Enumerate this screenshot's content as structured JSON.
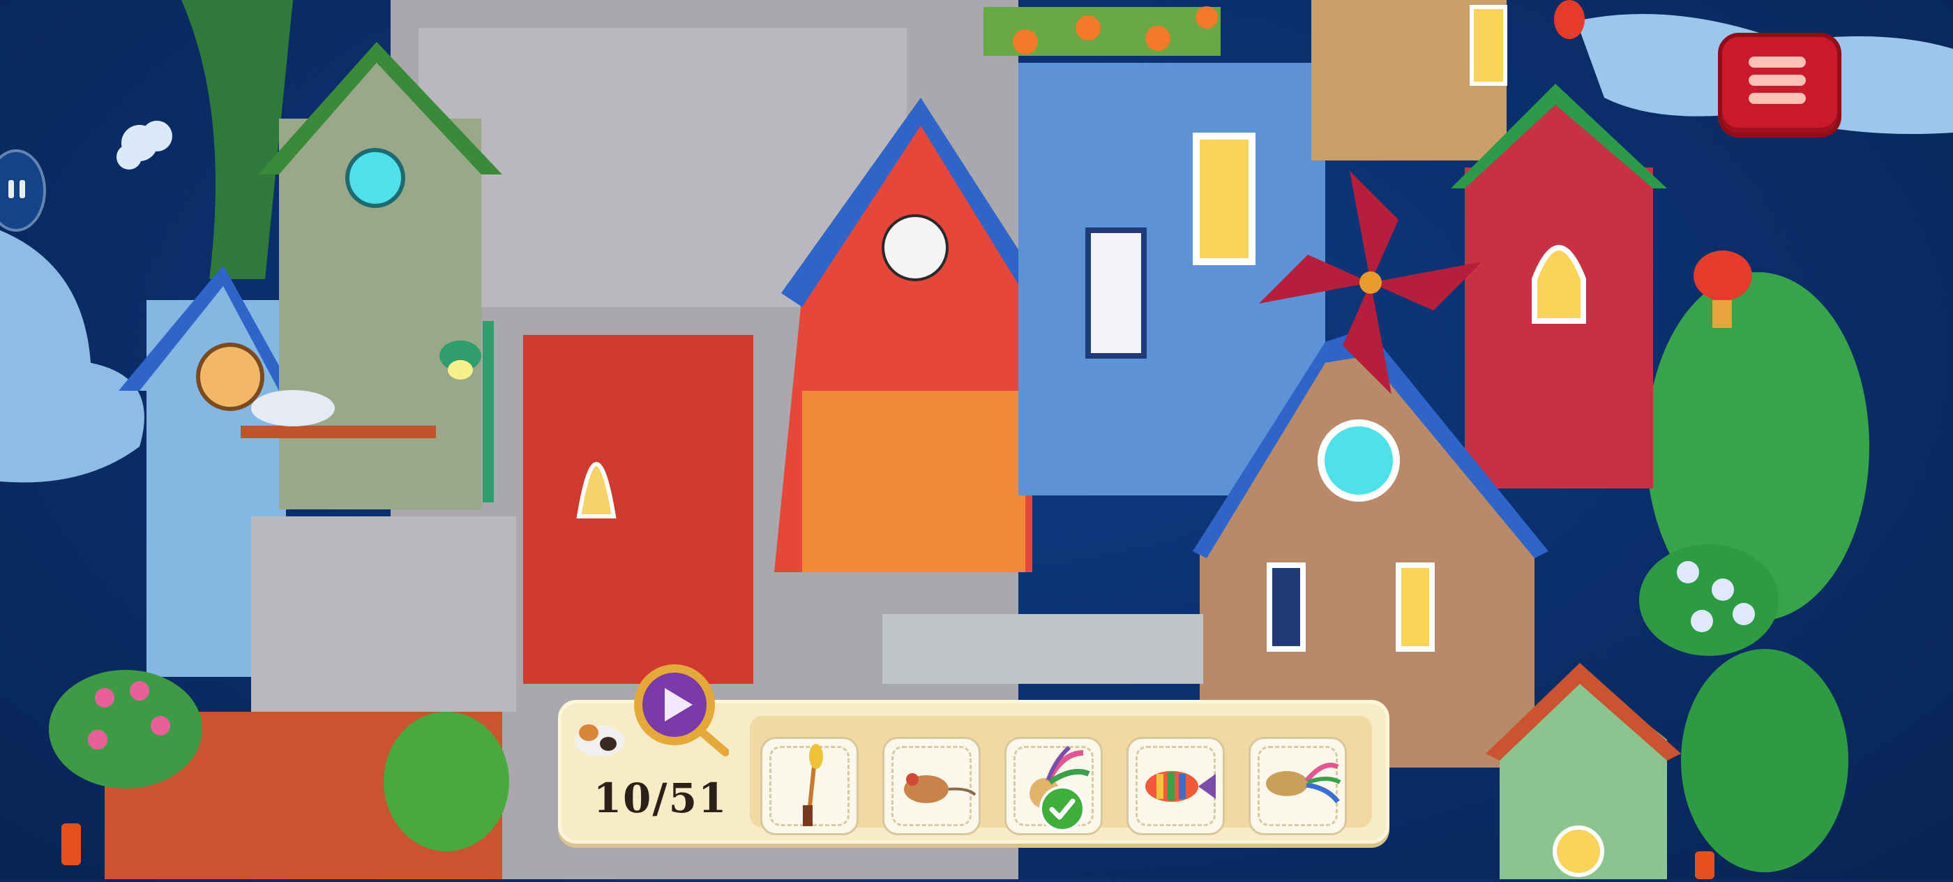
{
  "hud": {
    "found_counter": "10/51",
    "pause_icon": "pause-icon",
    "menu_icon": "hamburger-menu-icon",
    "hint_icon": "play-hint-icon"
  },
  "items_to_find": [
    {
      "icon": "feather-wand-icon",
      "found": false
    },
    {
      "icon": "toy-mouse-icon",
      "found": false
    },
    {
      "icon": "feather-toy-icon",
      "found": true
    },
    {
      "icon": "rainbow-fish-icon",
      "found": false
    },
    {
      "icon": "feather-fish-icon",
      "found": false
    }
  ],
  "colors": {
    "sky": "#0b2e6b",
    "menu_button": "#c9192a",
    "tray": "#f7ecc7",
    "found_check": "#3fae3a"
  }
}
